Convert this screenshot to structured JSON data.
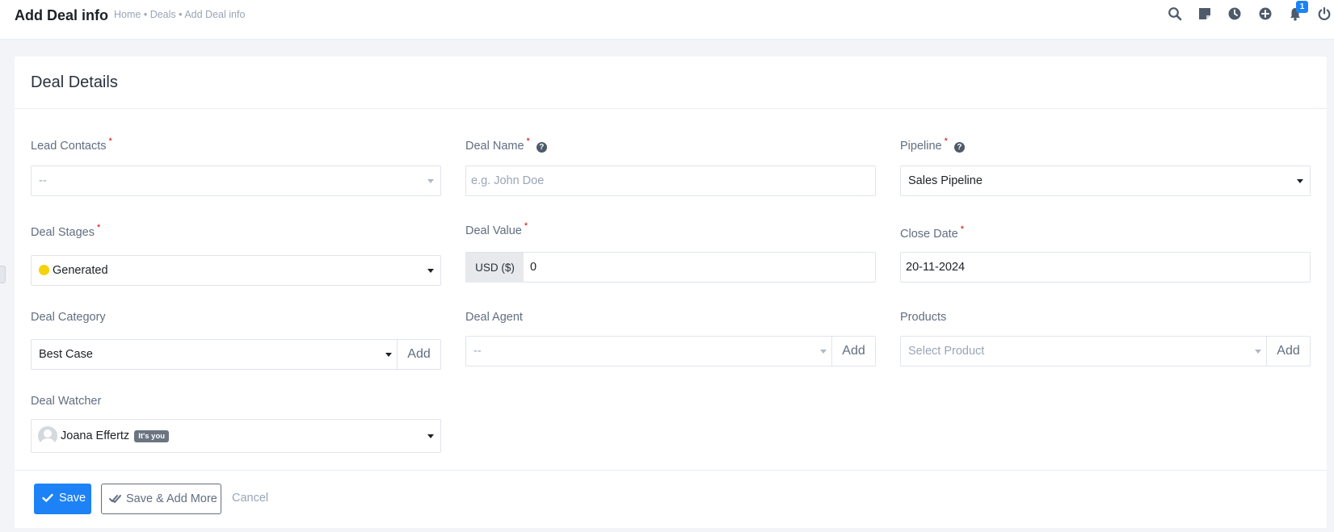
{
  "header": {
    "title": "Add Deal info",
    "breadcrumb": [
      "Home",
      "Deals",
      "Add Deal info"
    ],
    "breadcrumb_separator": "•",
    "icons": [
      "search-icon",
      "sticky-note-icon",
      "clock-icon",
      "plus-circle-icon",
      "bell-icon",
      "power-icon"
    ],
    "notification_count": "1"
  },
  "card": {
    "title": "Deal Details"
  },
  "form": {
    "lead_contacts": {
      "label": "Lead Contacts",
      "required": "*",
      "value": "--"
    },
    "deal_name": {
      "label": "Deal Name",
      "required": "*",
      "placeholder": "e.g. John Doe"
    },
    "pipeline": {
      "label": "Pipeline",
      "required": "*",
      "value": "Sales Pipeline"
    },
    "deal_stages": {
      "label": "Deal Stages",
      "required": "*",
      "value": "Generated",
      "dot_color": "#f5d20a"
    },
    "deal_value": {
      "label": "Deal Value",
      "required": "*",
      "currency": "USD ($)",
      "value": "0"
    },
    "close_date": {
      "label": "Close Date",
      "required": "*",
      "value": "20-11-2024"
    },
    "deal_category": {
      "label": "Deal Category",
      "value": "Best Case",
      "add_label": "Add"
    },
    "deal_agent": {
      "label": "Deal Agent",
      "value": "--",
      "add_label": "Add"
    },
    "products": {
      "label": "Products",
      "placeholder": "Select Product",
      "add_label": "Add"
    },
    "deal_watcher": {
      "label": "Deal Watcher",
      "value": "Joana Effertz",
      "badge": "It's you"
    }
  },
  "actions": {
    "save": "Save",
    "save_add_more": "Save & Add More",
    "cancel": "Cancel"
  },
  "colors": {
    "primary": "#1d82f5",
    "required": "#d30000",
    "muted_text": "#99a5b5"
  }
}
